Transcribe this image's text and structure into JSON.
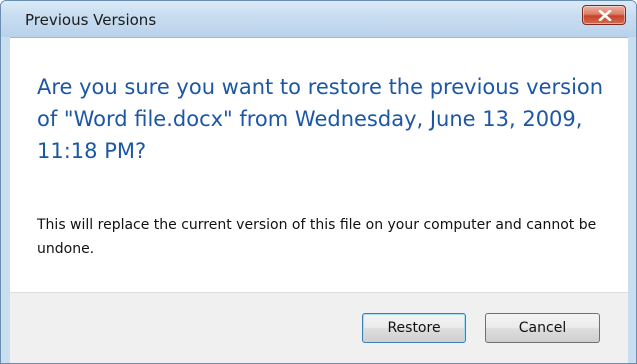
{
  "window": {
    "title": "Previous Versions"
  },
  "dialog": {
    "heading": "Are you sure you want to restore the previous version of \"Word file.docx\" from Wednesday, June 13, 2009, 11:18 PM?",
    "description": "This will replace the current version of this file on your computer and cannot be undone."
  },
  "buttons": {
    "restore_label": "Restore",
    "cancel_label": "Cancel"
  },
  "icons": {
    "close": "close-icon"
  },
  "colors": {
    "heading_text": "#1c57a6",
    "close_button": "#c5432a",
    "default_button_border": "#3c7fb1"
  }
}
